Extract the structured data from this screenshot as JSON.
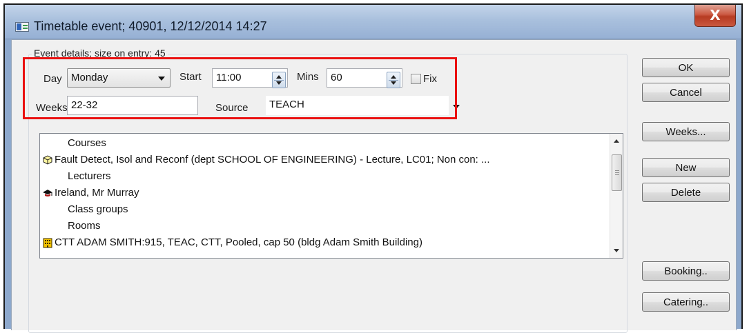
{
  "window": {
    "title": "Timetable event; 40901, 12/12/2014 14:27",
    "close_glyph": "X"
  },
  "event_details": {
    "legend": "Event details; size on entry: 45",
    "day_label": "Day",
    "day_value": "Monday",
    "start_label": "Start",
    "start_value": "11:00",
    "mins_label": "Mins",
    "mins_value": "60",
    "fix_label": "Fix",
    "fix_checked": false,
    "weeks_label": "Weeks",
    "weeks_value": "22-32",
    "source_label": "Source",
    "source_value": "TEACH"
  },
  "list": {
    "rows": [
      {
        "type": "header",
        "text": "Courses"
      },
      {
        "type": "item",
        "icon": "module-cube-icon",
        "text": "Fault Detect, Isol and Reconf (dept SCHOOL OF ENGINEERING) - Lecture, LC01; Non con: ..."
      },
      {
        "type": "header",
        "text": "Lecturers"
      },
      {
        "type": "item",
        "icon": "mortarboard-icon",
        "text": "Ireland, Mr Murray"
      },
      {
        "type": "header",
        "text": "Class groups"
      },
      {
        "type": "header",
        "text": "Rooms"
      },
      {
        "type": "item",
        "icon": "building-icon",
        "text": "CTT ADAM SMITH:915, TEAC, CTT, Pooled, cap 50 (bldg Adam Smith Building)"
      }
    ]
  },
  "buttons": {
    "ok": "OK",
    "cancel": "Cancel",
    "weeks": "Weeks...",
    "new": "New",
    "delete": "Delete",
    "booking": "Booking..",
    "catering": "Catering.."
  },
  "colors": {
    "highlight_box": "#ea1010",
    "titlebar": "#a9c0dd",
    "close_button": "#c9583f"
  }
}
